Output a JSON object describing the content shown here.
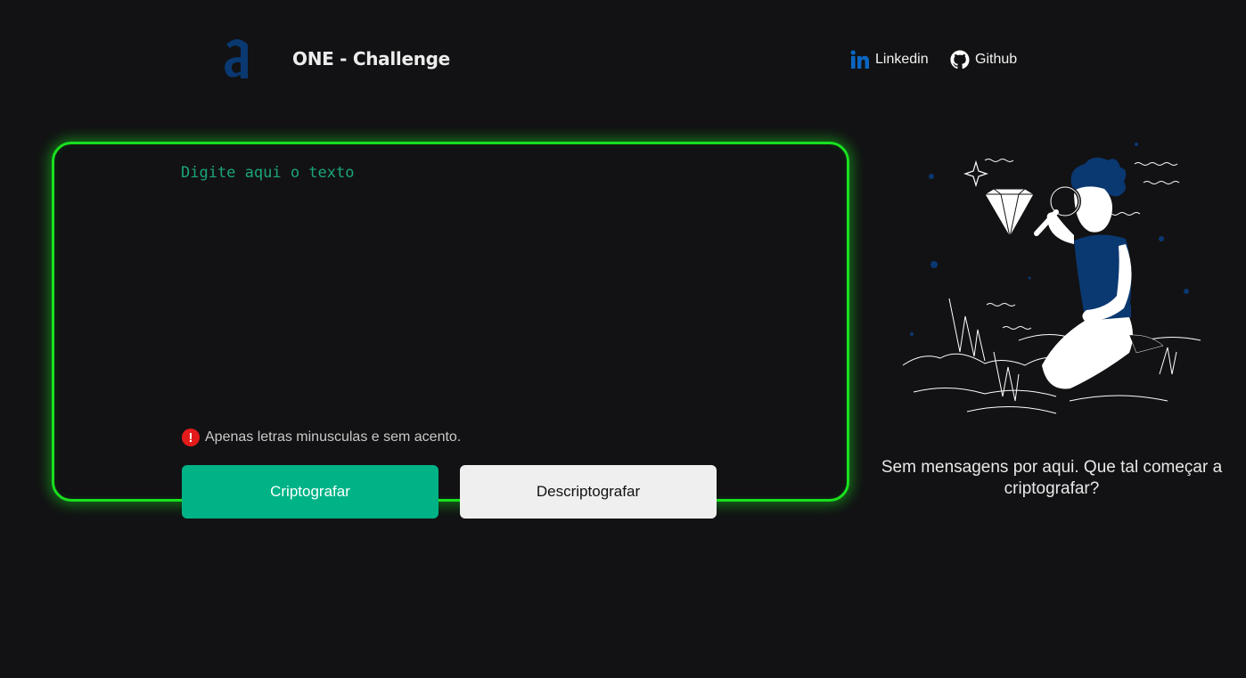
{
  "header": {
    "logo_icon": "alura-logo-icon",
    "title": "ONE - Challenge",
    "links": [
      {
        "label": "Linkedin",
        "icon": "linkedin-icon",
        "color": "#0a66c2"
      },
      {
        "label": "Github",
        "icon": "github-icon",
        "color": "#ffffff"
      }
    ]
  },
  "editor": {
    "placeholder": "Digite aqui o texto",
    "value": "",
    "hint": {
      "icon": "exclamation-icon",
      "text": "Apenas letras minusculas e sem acento."
    },
    "buttons": {
      "encrypt": "Criptografar",
      "decrypt": "Descriptografar"
    },
    "border_color": "#19e01f"
  },
  "output": {
    "illustration": "person-with-magnifying-glass-illustration",
    "message": "Sem mensagens por aqui. Que tal começar a criptografar?"
  },
  "colors": {
    "background": "#121214",
    "accent": "#00b386",
    "brand": "#0a3871"
  }
}
